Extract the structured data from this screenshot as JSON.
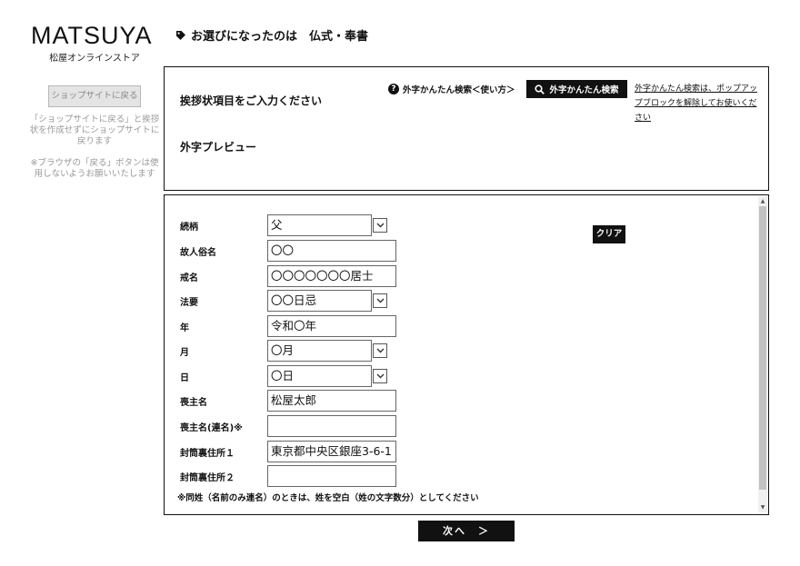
{
  "brand": {
    "logo_text": "MATSUYA",
    "sub_text": "松屋オンラインストア"
  },
  "page_heading": "お選びになったのは　仏式・奉書",
  "sidebar": {
    "back_button": "ショップサイトに戻る",
    "note1": "「ショップサイトに戻る」と挨拶状を作成せずにショップサイトに戻ります",
    "note2": "※ブラウザの「戻る」ボタンは使用しないようお願いいたします"
  },
  "top_panel": {
    "heading_input": "挨拶状項目をご入力ください",
    "heading_preview": "外字プレビュー",
    "howto_label": "外字かんたん検索＜使い方＞",
    "search_button": "外字かんたん検索",
    "popup_note": "外字かんたん検索は、ポップアップブロックを解除してお使いください"
  },
  "form": {
    "clear_button": "クリア",
    "fields": [
      {
        "label": "続柄",
        "value": "父"
      },
      {
        "label": "故人俗名",
        "value": "〇〇"
      },
      {
        "label": "戒名",
        "value": "〇〇〇〇〇〇〇居士"
      },
      {
        "label": "法要",
        "value": "〇〇日忌"
      },
      {
        "label": "年",
        "value": "令和〇年"
      },
      {
        "label": "月",
        "value": "〇月"
      },
      {
        "label": "日",
        "value": "〇日"
      },
      {
        "label": "喪主名",
        "value": "松屋太郎"
      },
      {
        "label": "喪主名(連名)※",
        "value": ""
      },
      {
        "label": "封筒裏住所１",
        "value": "東京都中央区銀座3-6-1"
      },
      {
        "label": "封筒裏住所２",
        "value": ""
      }
    ],
    "footnote": "※同姓（名前のみ連名）のときは、姓を空白（姓の文字数分）としてください"
  },
  "next_button": "次へ　＞"
}
